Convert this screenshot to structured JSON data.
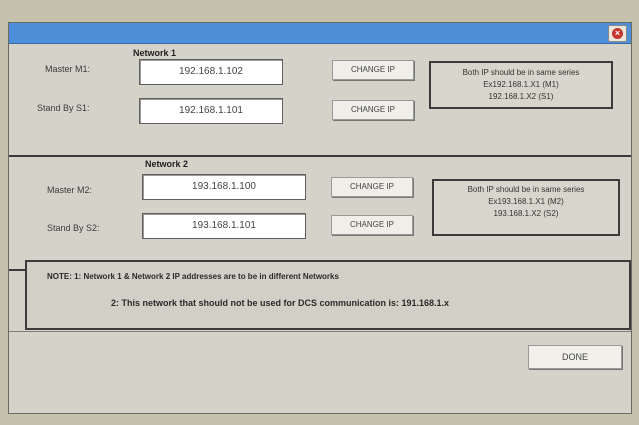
{
  "window": {
    "close_icon": "close-icon"
  },
  "network1": {
    "title": "Network 1",
    "master_label": "Master M1:",
    "master_ip": "192.168.1.102",
    "standby_label": "Stand By S1:",
    "standby_ip": "192.168.1.101",
    "change_ip_label": "CHANGE IP",
    "info": [
      "Both IP should be in same series",
      "Ex192.168.1.X1 (M1)",
      "192.168.1.X2 (S1)"
    ]
  },
  "network2": {
    "title": "Network 2",
    "master_label": "Master M2:",
    "master_ip": "193.168.1.100",
    "standby_label": "Stand By S2:",
    "standby_ip": "193.168.1.101",
    "change_ip_label": "CHANGE IP",
    "info": [
      "Both IP should be in same series",
      "Ex193.168.1.X1 (M2)",
      "193.168.1.X2 (S2)"
    ]
  },
  "note": {
    "line1": "NOTE:   1: Network 1 & Network 2 IP addresses are to be in different Networks",
    "line2": "2: This network that should not be used for DCS communication is: 191.168.1.x"
  },
  "done_label": "DONE"
}
